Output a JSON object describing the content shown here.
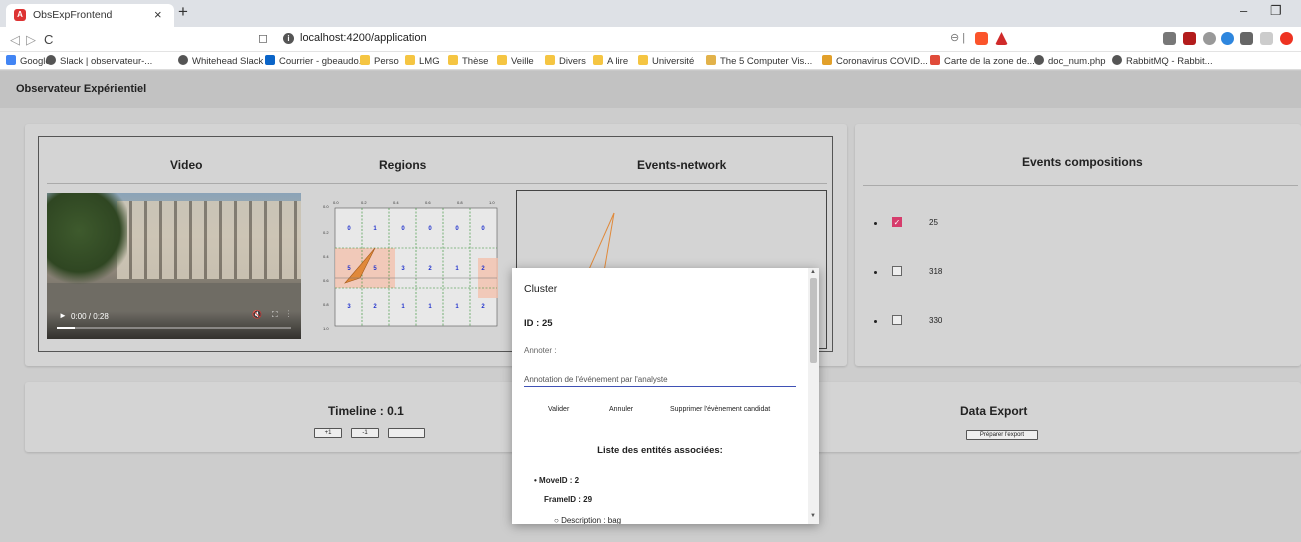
{
  "browser": {
    "tab_title": "ObsExpFrontend",
    "tab_icon": "A",
    "url": "localhost:4200/application",
    "bookmarks": [
      "Google",
      "Slack | observateur-...",
      "Whitehead Slack",
      "Courrier - gbeaudo...",
      "Perso",
      "LMG",
      "Thèse",
      "Veille",
      "Divers",
      "A lire",
      "Université",
      "The 5 Computer Vis...",
      "Coronavirus COVID...",
      "Carte de la zone de...",
      "doc_num.php",
      "RabbitMQ - Rabbit..."
    ]
  },
  "app": {
    "title": "Observateur Expérientiel",
    "panels": {
      "video": "Video",
      "regions": "Regions",
      "events_network": "Events-network",
      "events_compositions": "Events compositions",
      "timeline": "Timeline : 0.1",
      "data_export": "Data Export"
    },
    "video_time": "0:00 / 0:28",
    "compositions": [
      {
        "id": "25",
        "checked": true
      },
      {
        "id": "318",
        "checked": false
      },
      {
        "id": "330",
        "checked": false
      }
    ],
    "timeline_buttons": [
      "+1",
      "-1",
      ""
    ],
    "export_button": "Préparer l'export",
    "regions_axis": [
      "0.0",
      "0.2",
      "0.4",
      "0.6",
      "0.8",
      "1.0"
    ],
    "regions_grid": [
      [
        "0",
        "1",
        "0",
        "0",
        "0",
        "0"
      ],
      [
        "5",
        "5",
        "3",
        "2",
        "1",
        "2"
      ],
      [
        "3",
        "2",
        "1",
        "1",
        "1",
        "2"
      ]
    ]
  },
  "modal": {
    "title": "Cluster",
    "id_label": "ID : 25",
    "annotate_label": "Annoter :",
    "annotation_value": "Annotation de l'événement par l'analyste",
    "validate": "Valider",
    "cancel": "Annuler",
    "delete": "Supprimer l'évènement candidat",
    "list_title": "Liste des entités associées:",
    "entity_move": "MoveID : 2",
    "entity_frame": "FrameID : 29",
    "entity_desc": "Description : bag"
  },
  "colors": {
    "accent": "#3f51b5",
    "checkbox": "#d63c6c",
    "triangle": "#e0893a"
  }
}
